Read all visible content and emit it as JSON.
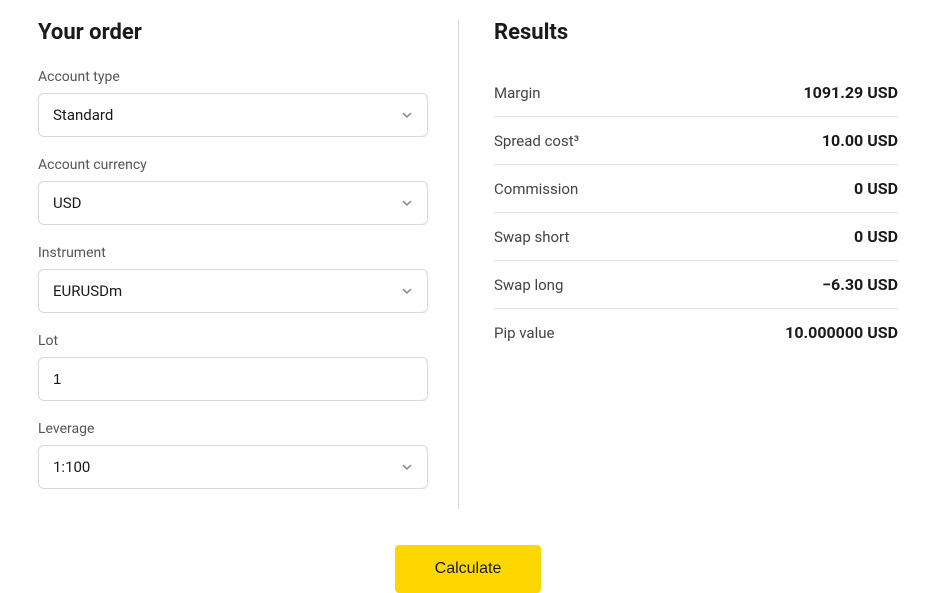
{
  "order": {
    "title": "Your order",
    "fields": {
      "accountType": {
        "label": "Account type",
        "value": "Standard"
      },
      "accountCurrency": {
        "label": "Account currency",
        "value": "USD"
      },
      "instrument": {
        "label": "Instrument",
        "value": "EURUSDm"
      },
      "lot": {
        "label": "Lot",
        "value": "1"
      },
      "leverage": {
        "label": "Leverage",
        "value": "1:100"
      }
    }
  },
  "results": {
    "title": "Results",
    "rows": {
      "margin": {
        "label": "Margin",
        "value": "1091.29 USD"
      },
      "spreadCost": {
        "label": "Spread cost³",
        "value": "10.00 USD"
      },
      "commission": {
        "label": "Commission",
        "value": "0 USD"
      },
      "swapShort": {
        "label": "Swap short",
        "value": "0 USD"
      },
      "swapLong": {
        "label": "Swap long",
        "value": "−6.30 USD"
      },
      "pipValue": {
        "label": "Pip value",
        "value": "10.000000 USD"
      }
    }
  },
  "button": {
    "calculate": "Calculate"
  }
}
